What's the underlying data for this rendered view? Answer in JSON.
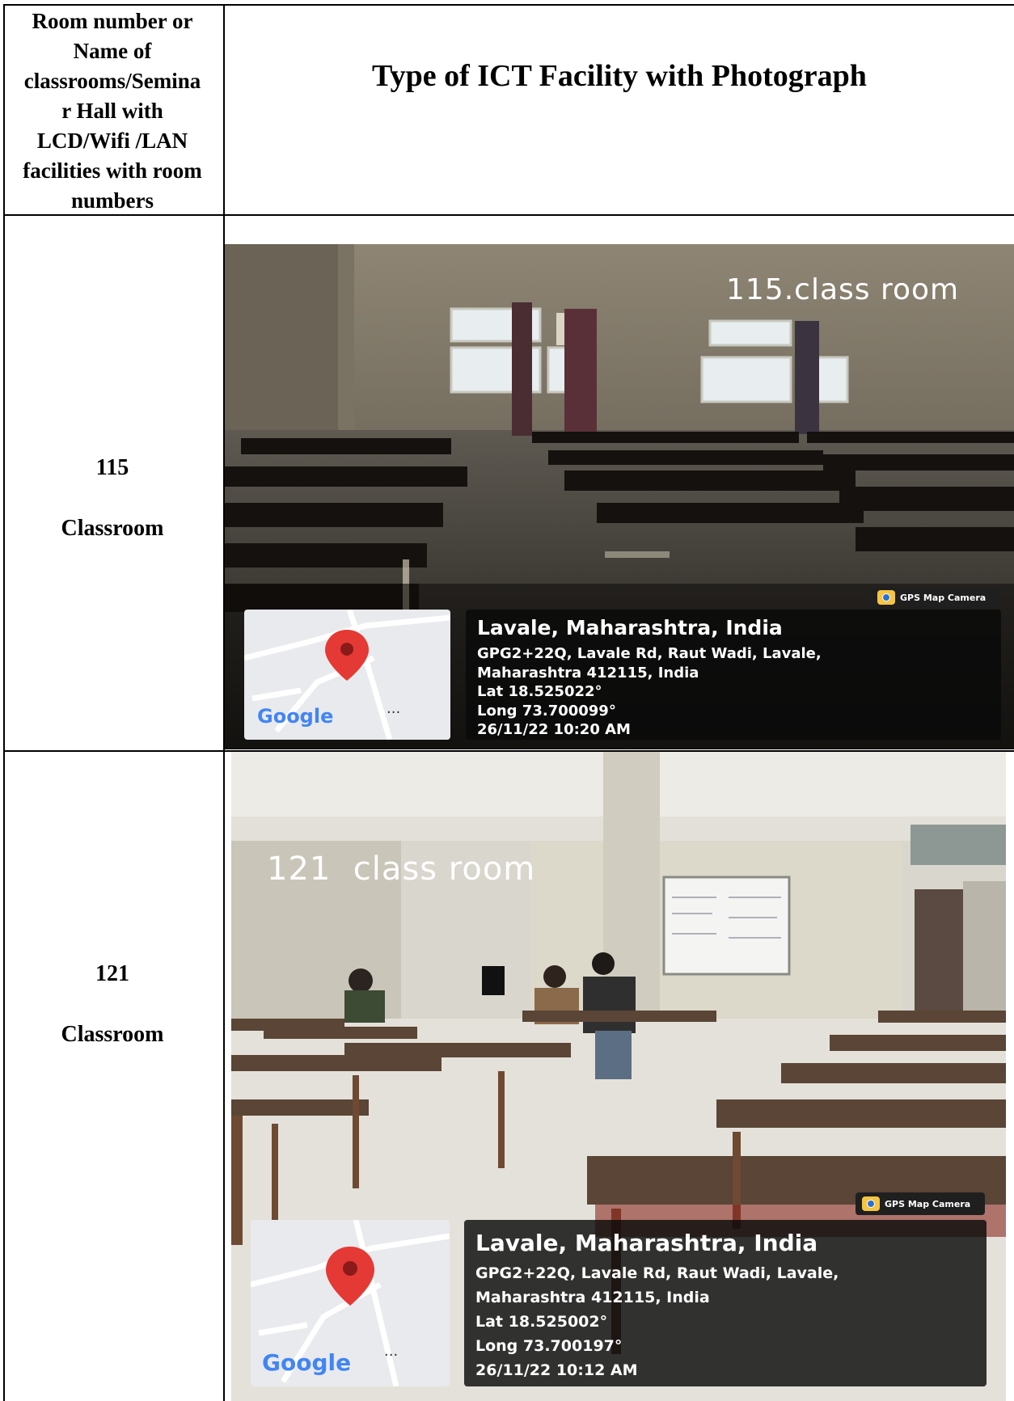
{
  "header": {
    "left_lines": [
      "Room number or",
      "Name of",
      "classrooms/Semina",
      "r Hall with",
      "LCD/Wifi /LAN",
      "facilities with room",
      "numbers"
    ],
    "right_title": "Type of ICT Facility with Photograph"
  },
  "rows": [
    {
      "number": "115",
      "type": "Classroom",
      "photo": {
        "caption": "115.class room",
        "badge": "GPS Map Camera",
        "map_brand": "Google",
        "map_more": "...",
        "place": "Lavale, Maharashtra, India",
        "address1": "GPG2+22Q, Lavale Rd, Raut Wadi, Lavale,",
        "address2": "Maharashtra 412115, India",
        "lat": "Lat 18.525022°",
        "long": "Long 73.700099°",
        "datetime": "26/11/22 10:20 AM"
      }
    },
    {
      "number": "121",
      "type": "Classroom",
      "photo": {
        "caption": "121  class room",
        "badge": "GPS Map Camera",
        "map_brand": "Google",
        "map_more": "...",
        "place": "Lavale, Maharashtra, India",
        "address1": "GPG2+22Q, Lavale Rd, Raut Wadi, Lavale,",
        "address2": "Maharashtra 412115, India",
        "lat": "Lat 18.525002°",
        "long": "Long 73.700197°",
        "datetime": "26/11/22 10:12 AM"
      }
    }
  ],
  "colors": {
    "border": "#000000",
    "map_pin": "#e53935",
    "overlay": "#0a0a0a"
  }
}
